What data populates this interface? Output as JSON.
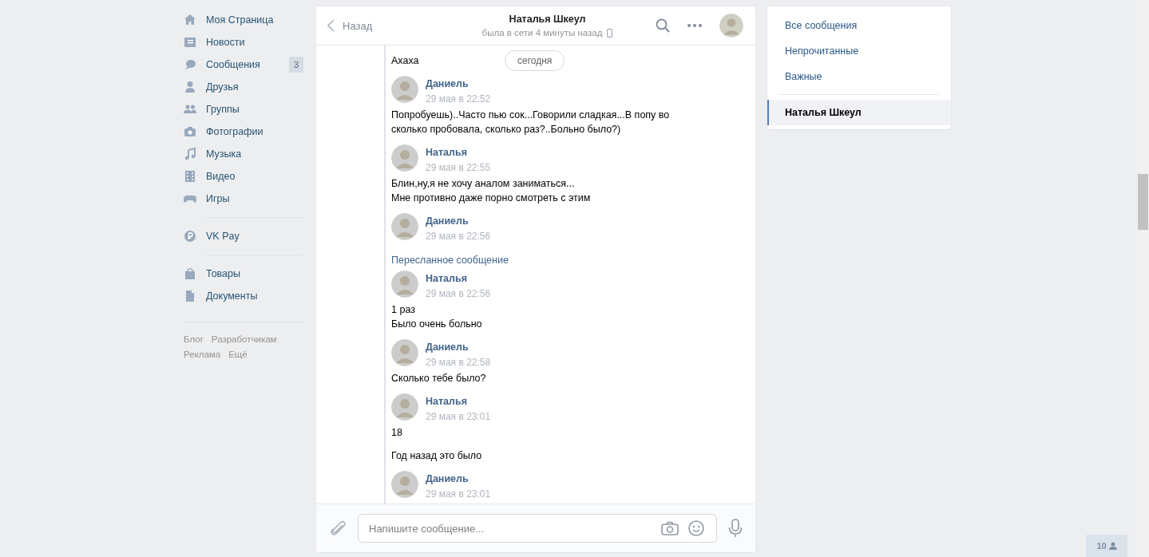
{
  "sidebar": {
    "groups": [
      {
        "items": [
          {
            "label": "Моя Страница",
            "selected": false
          },
          {
            "label": "Новости",
            "selected": false
          },
          {
            "label": "Сообщения",
            "selected": false,
            "badge": "3"
          },
          {
            "label": "Друзья",
            "selected": false
          },
          {
            "label": "Группы",
            "selected": false
          },
          {
            "label": "Фотографии",
            "selected": false
          },
          {
            "label": "Музыка",
            "selected": false
          },
          {
            "label": "Видео",
            "selected": false
          },
          {
            "label": "Игры",
            "selected": false
          }
        ]
      },
      {
        "items": [
          {
            "label": "VK Pay",
            "selected": false
          }
        ]
      },
      {
        "items": [
          {
            "label": "Товары",
            "selected": false
          },
          {
            "label": "Документы",
            "selected": false
          }
        ]
      }
    ],
    "footer_links": [
      [
        "Блог",
        "Разработчикам"
      ],
      [
        "Реклама",
        "Ещё"
      ]
    ]
  },
  "chat": {
    "back": "Назад",
    "title": "Наталья Шкеул",
    "status": "была в сети 4 минуты назад",
    "date_pill": "сегодня",
    "forwarded_label": "Пересланное сообщение",
    "messages": [
      {
        "kind": "text",
        "lines": [
          "Ахаха"
        ]
      },
      {
        "kind": "author",
        "name": "Даниель",
        "time": "29 мая в 22:52"
      },
      {
        "kind": "text",
        "lines": [
          "Попробуешь)..Часто пью сок...Говорили сладкая...В попу во сколько пробовала, сколько раз?..Больно было?)"
        ]
      },
      {
        "kind": "author",
        "name": "Наталья",
        "time": "29 мая в 22:55"
      },
      {
        "kind": "text",
        "lines": [
          "Блин,ну,я не хочу аналом заниматься...",
          "Мне противно даже порно смотреть с этим"
        ]
      },
      {
        "kind": "author",
        "name": "Даниель",
        "time": "29 мая в 22:56"
      },
      {
        "kind": "forwarded"
      },
      {
        "kind": "author",
        "name": "Наталья",
        "time": "29 мая в 22:56"
      },
      {
        "kind": "text",
        "lines": [
          "1 раз",
          "Было очень больно"
        ]
      },
      {
        "kind": "author",
        "name": "Даниель",
        "time": "29 мая в 22:58"
      },
      {
        "kind": "text",
        "lines": [
          "Сколько тебе было?"
        ]
      },
      {
        "kind": "author",
        "name": "Наталья",
        "time": "29 мая в 23:01"
      },
      {
        "kind": "text",
        "lines": [
          "18"
        ]
      },
      {
        "kind": "text",
        "lines": [
          "Год назад это было"
        ]
      },
      {
        "kind": "author",
        "name": "Даниель",
        "time": "29 мая в 23:01"
      }
    ],
    "composer": {
      "placeholder": "Напишите сообщение..."
    }
  },
  "filters": {
    "items": [
      {
        "label": "Все сообщения",
        "selected": false
      },
      {
        "label": "Непрочитанные",
        "selected": false
      },
      {
        "label": "Важные",
        "selected": false
      }
    ],
    "dialogs": [
      {
        "label": "Наталья Шкеул",
        "selected": true
      }
    ]
  },
  "online_badge": "10"
}
